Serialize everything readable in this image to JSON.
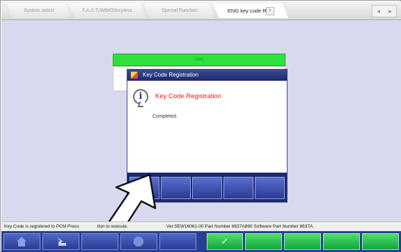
{
  "tabs": [
    {
      "label": "System select",
      "active": false
    },
    {
      "label": "F.A.S.T./IMMO/Keyless",
      "active": false
    },
    {
      "label": "Special Function",
      "active": false
    },
    {
      "label": "ENG key code Reg.",
      "active": true
    }
  ],
  "tab_close_glyph": "×",
  "nav": {
    "prev_glyph": "◂",
    "next_glyph": "▸"
  },
  "table": {
    "header": "Item"
  },
  "dialog": {
    "title": "Key Code Registration",
    "heading": "Key Code Registration",
    "message": "Completed.",
    "confirm_glyph": "✓",
    "icon": "info-icon"
  },
  "status": {
    "instruction": "Key Code is registered to PCM Press",
    "instruction_tail": "tton to execute.",
    "version": "Ver.SEW16061-00 Part Number 8637A890   Software Part Number 8637A."
  },
  "toolbar": {
    "home_icon": "home-icon",
    "back_icon": "back-arrow-icon",
    "stop_icon": "stop-icon",
    "confirm_glyph": "✓"
  },
  "colors": {
    "accent": "#2b3d93",
    "confirm_green": "#15a33a",
    "header_green": "#2ee23c",
    "dialog_heading": "#e02020",
    "workspace": "#d8d8ee"
  }
}
